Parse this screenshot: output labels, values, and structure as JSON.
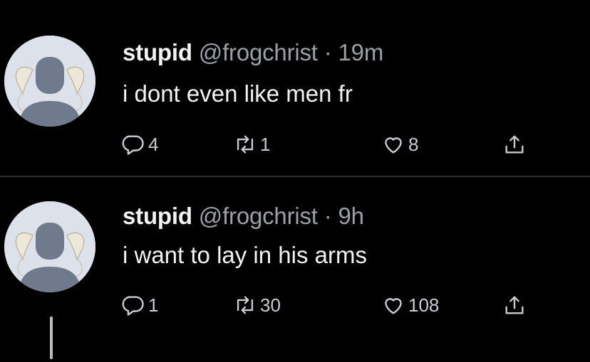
{
  "tweets": [
    {
      "display_name": "stupid",
      "handle": "@frogchrist",
      "separator": "·",
      "time": "19m",
      "text": "i dont even like men fr",
      "reply_count": "4",
      "retweet_count": "1",
      "like_count": "8"
    },
    {
      "display_name": "stupid",
      "handle": "@frogchrist",
      "separator": "·",
      "time": "9h",
      "text": "i want to lay in his arms",
      "reply_count": "1",
      "retweet_count": "30",
      "like_count": "108"
    }
  ],
  "icons": {
    "reply": "reply-icon",
    "retweet": "retweet-icon",
    "like": "heart-icon",
    "share": "share-icon"
  },
  "colors": {
    "background": "#000000",
    "text": "#f2f2f2",
    "muted": "#9aa0a6"
  }
}
